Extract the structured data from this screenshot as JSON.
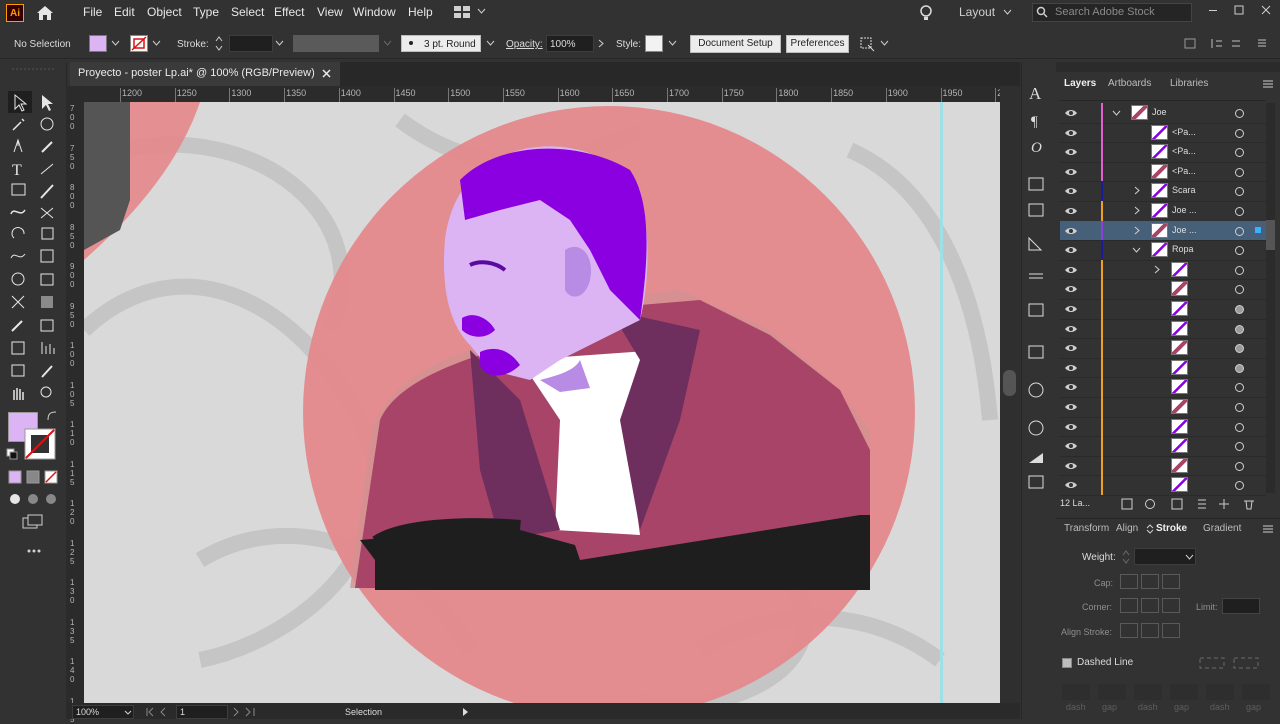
{
  "app": {
    "icon_label": "Ai"
  },
  "menu": [
    "File",
    "Edit",
    "Object",
    "Type",
    "Select",
    "Effect",
    "View",
    "Window",
    "Help"
  ],
  "workspace": {
    "label": "Layout"
  },
  "search": {
    "placeholder": "Search Adobe Stock"
  },
  "control_bar": {
    "selection_label": "No Selection",
    "stroke_label": "Stroke:",
    "brush_value": "3 pt. Round",
    "opacity_label": "Opacity:",
    "opacity_value": "100%",
    "style_label": "Style:",
    "document_setup": "Document Setup",
    "preferences": "Preferences"
  },
  "document_tab": {
    "title": "Proyecto - poster Lp.ai* @ 100% (RGB/Preview)"
  },
  "ruler": {
    "h_ticks": [
      "1200",
      "1250",
      "1300",
      "1350",
      "1400",
      "1450",
      "1500",
      "1550",
      "1600",
      "1650",
      "1700",
      "1750",
      "1800",
      "1850",
      "1900",
      "1950",
      "2"
    ],
    "v_ticks": [
      "7\n0\n0",
      "7\n5\n0",
      "8\n0\n0",
      "8\n5\n0",
      "9\n0\n0",
      "9\n5\n0",
      "1\n0\n0",
      "1\n0\n5",
      "1\n1\n0",
      "1\n1\n5",
      "1\n2\n0",
      "1\n2\n5",
      "1\n3\n0",
      "1\n3\n5",
      "1\n4\n0",
      "1\n4\n5"
    ]
  },
  "status": {
    "zoom": "100%",
    "artboard_num": "1",
    "mode": "Selection"
  },
  "colors": {
    "fill": "#dcb4f4",
    "accent_purple": "#8a00e0",
    "circle": "#e4878a",
    "jacket": "#a84467"
  },
  "panels": {
    "tabs": [
      "Layers",
      "Artboards",
      "Libraries"
    ],
    "footer_count": "12 La...",
    "layers": [
      {
        "name": "Joe",
        "indent": 0,
        "twirl": "open",
        "color": "#e060d0"
      },
      {
        "name": "<Pa...",
        "indent": 1,
        "twirl": "",
        "color": "#e060d0"
      },
      {
        "name": "<Pa...",
        "indent": 1,
        "twirl": "",
        "color": "#e060d0"
      },
      {
        "name": "<Pa...",
        "indent": 1,
        "twirl": "",
        "color": "#e060d0"
      },
      {
        "name": "Scara",
        "indent": 1,
        "twirl": "closed",
        "color": "#1b1b9c"
      },
      {
        "name": "Joe ...",
        "indent": 1,
        "twirl": "closed",
        "color": "#f0a020"
      },
      {
        "name": "Joe ...",
        "indent": 1,
        "twirl": "closed",
        "color": "#8a40e0"
      },
      {
        "name": "Ropa",
        "indent": 1,
        "twirl": "open",
        "color": "#1b1b9c"
      },
      {
        "name": "",
        "indent": 2,
        "twirl": "closed",
        "color": "#f0a020"
      },
      {
        "name": "",
        "indent": 2,
        "twirl": "",
        "color": "#f0a020"
      },
      {
        "name": "",
        "indent": 2,
        "twirl": "",
        "color": "#f0a020"
      },
      {
        "name": "",
        "indent": 2,
        "twirl": "",
        "color": "#f0a020"
      },
      {
        "name": "",
        "indent": 2,
        "twirl": "",
        "color": "#f0a020"
      },
      {
        "name": "",
        "indent": 2,
        "twirl": "",
        "color": "#f0a020"
      },
      {
        "name": "",
        "indent": 2,
        "twirl": "",
        "color": "#f0a020"
      },
      {
        "name": "",
        "indent": 2,
        "twirl": "",
        "color": "#f0a020"
      },
      {
        "name": "",
        "indent": 2,
        "twirl": "",
        "color": "#f0a020"
      },
      {
        "name": "",
        "indent": 2,
        "twirl": "",
        "color": "#f0a020"
      },
      {
        "name": "",
        "indent": 2,
        "twirl": "",
        "color": "#f0a020"
      },
      {
        "name": "",
        "indent": 2,
        "twirl": "",
        "color": "#f0a020"
      }
    ],
    "stroke_tabs": [
      "Transform",
      "Align",
      "Stroke",
      "Gradient"
    ],
    "stroke": {
      "weight_label": "Weight:",
      "cap_label": "Cap:",
      "corner_label": "Corner:",
      "limit_label": "Limit:",
      "align_label": "Align Stroke:",
      "dashed_label": "Dashed Line",
      "dash_labels": [
        "dash",
        "gap",
        "dash",
        "gap",
        "dash",
        "gap"
      ]
    }
  }
}
